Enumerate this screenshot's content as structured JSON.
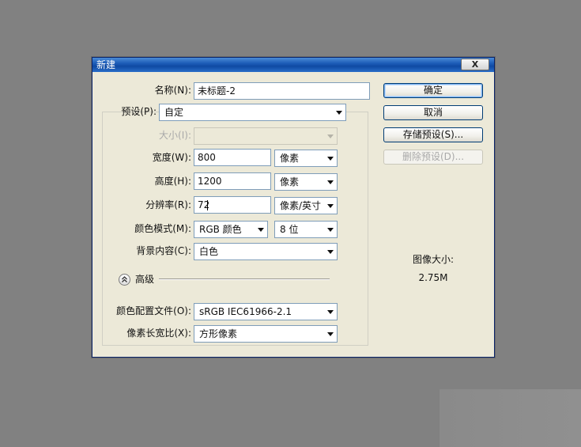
{
  "dialog": {
    "title": "新建",
    "close_label": "X"
  },
  "form": {
    "name": {
      "label": "名称(N):",
      "value": "未标题-2"
    },
    "preset": {
      "label": "预设(P):",
      "value": "自定"
    },
    "size": {
      "label": "大小(I):",
      "value": ""
    },
    "width": {
      "label": "宽度(W):",
      "value": "800",
      "unit": "像素"
    },
    "height": {
      "label": "高度(H):",
      "value": "1200",
      "unit": "像素"
    },
    "resolution": {
      "label": "分辨率(R):",
      "value": "72",
      "unit": "像素/英寸"
    },
    "color_mode": {
      "label": "颜色模式(M):",
      "value": "RGB 颜色",
      "depth": "8 位"
    },
    "background": {
      "label": "背景内容(C):",
      "value": "白色"
    },
    "advanced": {
      "label": "高级",
      "icon": "collapse-up-icon"
    },
    "color_profile": {
      "label": "颜色配置文件(O):",
      "value": "sRGB IEC61966-2.1"
    },
    "pixel_aspect": {
      "label": "像素长宽比(X):",
      "value": "方形像素"
    }
  },
  "buttons": {
    "ok": "确定",
    "cancel": "取消",
    "save_preset": "存储预设(S)...",
    "delete_preset": "删除预设(D)..."
  },
  "image_size": {
    "label": "图像大小:",
    "value": "2.75M"
  },
  "colors": {
    "background": "#818181",
    "dialog": "#ece9d8",
    "titlebar": "#1c5bb7",
    "button_border": "#003c74"
  }
}
